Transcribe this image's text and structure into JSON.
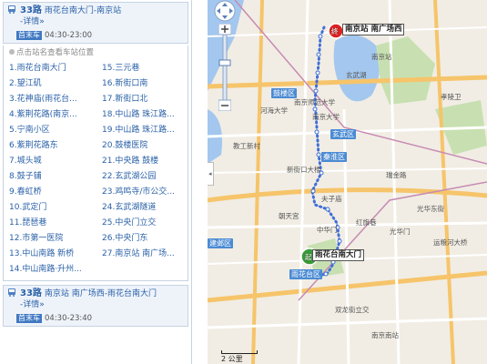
{
  "routes": [
    {
      "name": "33路",
      "description": "雨花台南大门-南京站",
      "detail": "-详情»",
      "first_bus_label": "首末车",
      "hours": "04:30-23:00"
    },
    {
      "name": "33路",
      "description": "南京站 南广场西-雨花台南大门",
      "detail": "-详情»",
      "first_bus_label": "首末车",
      "hours": "04:30-23:40"
    }
  ],
  "stations_hint": "点击站名查看车站位置",
  "stops": [
    "1.雨花台南大门",
    "15.三元巷",
    "2.望江矶",
    "16.新街口南",
    "3.花神庙(雨花台...",
    "17.新街口北",
    "4.紫荆花路(南京...",
    "18.中山路 珠江路...",
    "5.宁南小区",
    "19.中山路 珠江路...",
    "6.紫荆花路东",
    "20.鼓楼医院",
    "7.城头城",
    "21.中央路 鼓楼",
    "8.鼓子铺",
    "22.玄武湖公园",
    "9.春虹桥",
    "23.鸡鸣寺/市公交...",
    "10.武定门",
    "24.玄武湖隧道",
    "11.琵琶巷",
    "25.中央门立交",
    "12.市第一医院",
    "26.中央门东",
    "13.中山南路 新桥",
    "27.南京站 南广场...",
    "14.中山南路·升州..."
  ],
  "map": {
    "start_label": "雨花台南大门",
    "end_label": "南京站 南广场西",
    "start_marker": "起",
    "end_marker": "终",
    "scale": "2 公里",
    "districts": [
      "鼓楼区",
      "玄武区",
      "秦淮区",
      "雨花台区",
      "建邺区"
    ],
    "places": {
      "nanjing_station": "南京站",
      "hehai_univ": "河海大学",
      "nanjing_univ": "南京大学",
      "nanjing_normal": "南京师范大学",
      "xinjiekou": "新街口大楼",
      "fuzimiao": "夫子庙",
      "chaotiangong": "朝天宫",
      "jiaoyu": "教工新村",
      "ruijin": "瑞金路",
      "guanghua": "光华东街",
      "yuntang": "运粮河大桥",
      "hongqiao": "红旗巷",
      "guanghua_gate": "光华门",
      "zhonghua_gate": "中华门",
      "shuangmen": "双龙街立交",
      "xiaolingwei": "孝陵卫",
      "xuanwu_lake": "玄武湖",
      "south_station": "南京南站"
    },
    "colors": {
      "route": "#3f6ed8",
      "water": "#a3c7ee",
      "park": "#c8e0b1",
      "highway": "#f6c46a",
      "road": "#ffffff"
    }
  }
}
